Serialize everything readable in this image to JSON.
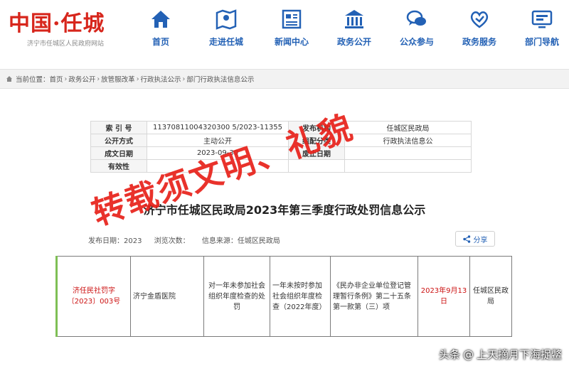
{
  "site": {
    "logo_text": "中国·任城",
    "logo_sub": "济宁市任城区人民政府网站"
  },
  "nav": [
    {
      "label": "首页",
      "icon": "home-icon"
    },
    {
      "label": "走进任城",
      "icon": "map-pin-icon"
    },
    {
      "label": "新闻中心",
      "icon": "newspaper-icon"
    },
    {
      "label": "政务公开",
      "icon": "building-icon"
    },
    {
      "label": "公众参与",
      "icon": "chat-icon"
    },
    {
      "label": "政务服务",
      "icon": "heart-hand-icon"
    },
    {
      "label": "部门导航",
      "icon": "monitor-icon"
    }
  ],
  "breadcrumb": {
    "prefix": "当前位置：",
    "items": [
      "首页",
      "政务公开",
      "放管服改革",
      "行政执法公示",
      "部门行政执法信息公示"
    ]
  },
  "info": {
    "index_label": "索 引 号",
    "index_value": "11370811004320300 5/2023-11355",
    "publisher_label": "发布机构",
    "publisher_value": "任城区民政局",
    "method_label": "公开方式",
    "method_value": "主动公开",
    "category_label": "组配分类",
    "category_value": "行政执法信息公",
    "date_label": "成文日期",
    "date_value": "2023-09-30",
    "abolish_label": "废止日期",
    "abolish_value": "",
    "validity_label": "有效性",
    "validity_value": ""
  },
  "document": {
    "title": "济宁市任城区民政局2023年第三季度行政处罚信息公示",
    "publish_time": "发布日期：2023",
    "views": "浏览次数：",
    "source": "信息来源：任城区民政局",
    "share_label": "分享"
  },
  "penalty_row": {
    "doc_no": "济任民社罚字〔2023〕003号",
    "party": "济宁金盾医院",
    "reason": "对一年未参加社会组织年度检查的处罚",
    "facts": "一年未按时参加社会组织年度检查（2022年度）",
    "basis": "《民办非企业单位登记管理暂行条例》第二十五条第一款第（三）项",
    "date": "2023年9月13日",
    "authority": "任城区民政局"
  },
  "watermark": {
    "line1": "转载须文明、礼貌"
  },
  "footer": {
    "platform": "头条",
    "handle": "上天摘月下海捉鳖"
  },
  "colors": {
    "brand_red": "#d7261c",
    "nav_blue": "#2361b5",
    "watermark_red": "#e8211a"
  }
}
